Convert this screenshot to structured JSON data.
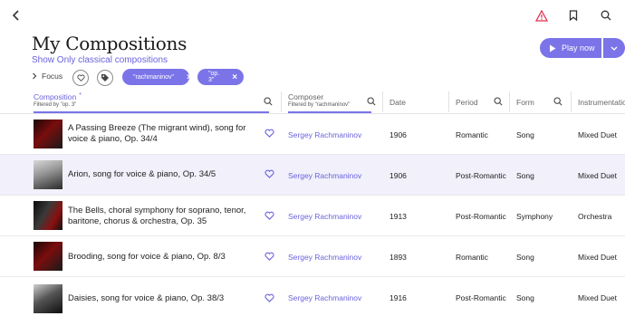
{
  "page": {
    "title": "My Compositions",
    "filter_link": "Show Only classical compositions",
    "focus_label": "Focus",
    "play_now_label": "Play now"
  },
  "chips": [
    {
      "label": "\"rachmaninov\""
    },
    {
      "label": "\"op. 3\""
    }
  ],
  "columns": {
    "composition": {
      "label": "Composition",
      "sort_mark": "*",
      "sub": "Filtered by \"op. 3\""
    },
    "composer": {
      "label": "Composer",
      "sub": "Filtered by \"rachmaninov\""
    },
    "date": {
      "label": "Date"
    },
    "period": {
      "label": "Period"
    },
    "form": {
      "label": "Form"
    },
    "instrumentation": {
      "label": "Instrumentation"
    }
  },
  "rows": [
    {
      "line1": "A Passing Breeze (The migrant wind), song for",
      "line2": "voice & piano, Op. 34/4",
      "composer": "Sergey Rachmaninov",
      "date": "1906",
      "period": "Romantic",
      "form": "Song",
      "instrumentation": "Mixed Duet",
      "selected": false
    },
    {
      "line1": "Arion, song for voice & piano, Op. 34/5",
      "line2": "",
      "composer": "Sergey Rachmaninov",
      "date": "1906",
      "period": "Post-Romantic",
      "form": "Song",
      "instrumentation": "Mixed Duet",
      "selected": true
    },
    {
      "line1": "The Bells, choral symphony for soprano, tenor,",
      "line2": "baritone, chorus & orchestra, Op. 35",
      "composer": "Sergey Rachmaninov",
      "date": "1913",
      "period": "Post-Romantic",
      "form": "Symphony",
      "instrumentation": "Orchestra",
      "selected": false
    },
    {
      "line1": "Brooding, song for voice & piano, Op. 8/3",
      "line2": "",
      "composer": "Sergey Rachmaninov",
      "date": "1893",
      "period": "Romantic",
      "form": "Song",
      "instrumentation": "Mixed Duet",
      "selected": false
    },
    {
      "line1": "Daisies, song for voice & piano, Op. 38/3",
      "line2": "",
      "composer": "Sergey Rachmaninov",
      "date": "1916",
      "period": "Post-Romantic",
      "form": "Song",
      "instrumentation": "Mixed Duet",
      "selected": false
    }
  ],
  "colors": {
    "accent": "#7b74e8",
    "alert": "#e0334f"
  }
}
